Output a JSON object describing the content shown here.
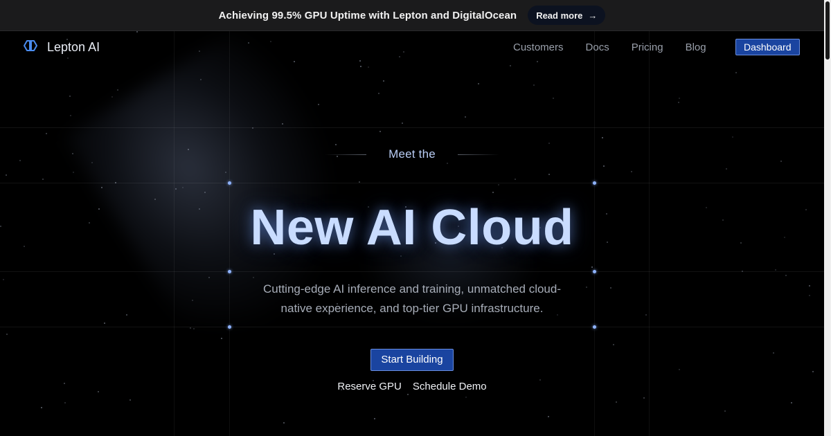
{
  "announcement": {
    "text": "Achieving 99.5% GPU Uptime with Lepton and DigitalOcean",
    "button_label": "Read more",
    "button_icon": "arrow-right-icon"
  },
  "nav": {
    "brand": "Lepton AI",
    "logo_icon": "lepton-logo-icon",
    "links": [
      "Customers",
      "Docs",
      "Pricing",
      "Blog"
    ],
    "dashboard_label": "Dashboard"
  },
  "hero": {
    "eyebrow": "Meet the",
    "title": "New AI Cloud",
    "subtitle": "Cutting-edge AI inference and training, unmatched cloud-native experience, and top-tier GPU infrastructure.",
    "primary_cta": "Start Building",
    "secondary_ctas": [
      "Reserve GPU",
      "Schedule Demo"
    ]
  },
  "colors": {
    "accent_button": "#1a44a0",
    "title_glow": "#c9dcff",
    "announcement_bg": "#1b1b1c",
    "page_bg": "#000000"
  }
}
